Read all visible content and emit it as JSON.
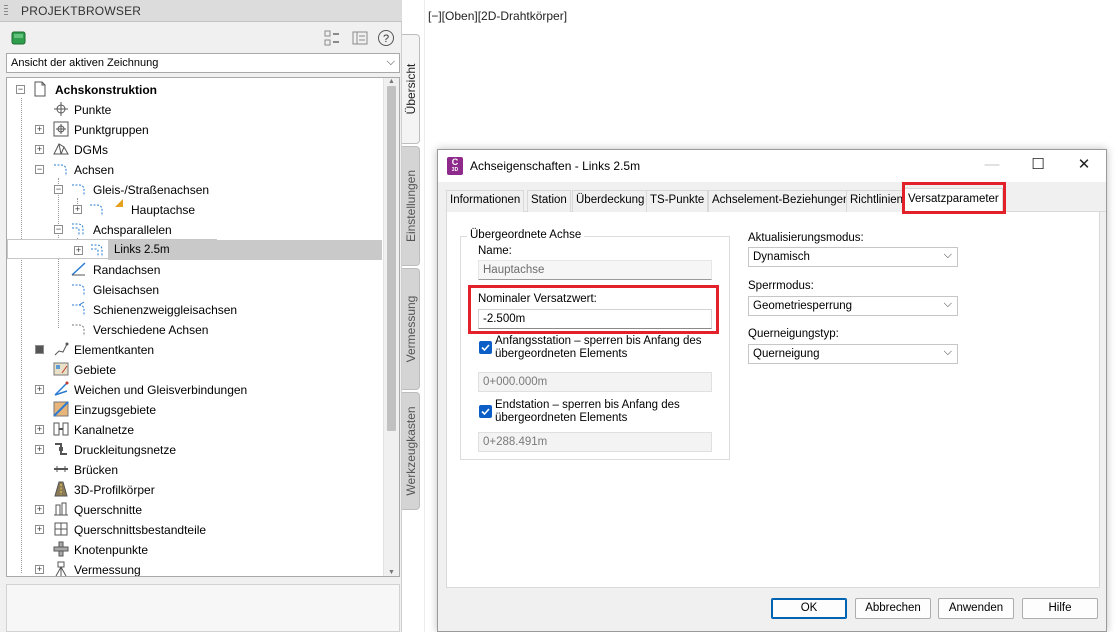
{
  "project_browser": {
    "title": "PROJEKTBROWSER",
    "view_selector": "Ansicht der aktiven Zeichnung",
    "side_tabs": [
      "Übersicht",
      "Einstellungen",
      "Vermessung",
      "Werkzeugkasten"
    ],
    "tree": {
      "root": "Achskonstruktion",
      "items": [
        {
          "label": "Punkte",
          "icon": "point-icon"
        },
        {
          "label": "Punktgruppen",
          "icon": "point-group-icon"
        },
        {
          "label": "DGMs",
          "icon": "surface-icon"
        },
        {
          "label": "Achsen",
          "icon": "alignment-icon"
        },
        {
          "label": "Gleis-/Straßenachsen",
          "icon": "alignment-icon"
        },
        {
          "label": "Hauptachse",
          "icon": "alignment-icon"
        },
        {
          "label": "Achsparallelen",
          "icon": "offset-alignment-icon"
        },
        {
          "label": "Links 2.5m",
          "icon": "offset-alignment-icon"
        },
        {
          "label": "Randachsen",
          "icon": "curb-alignment-icon"
        },
        {
          "label": "Gleisachsen",
          "icon": "rail-alignment-icon"
        },
        {
          "label": "Schienenzweiggleisachsen",
          "icon": "rail-branch-icon"
        },
        {
          "label": "Verschiedene Achsen",
          "icon": "misc-alignment-icon"
        },
        {
          "label": "Elementkanten",
          "icon": "feature-line-icon"
        },
        {
          "label": "Gebiete",
          "icon": "site-icon"
        },
        {
          "label": "Weichen und Gleisverbindungen",
          "icon": "turnout-icon"
        },
        {
          "label": "Einzugsgebiete",
          "icon": "catchment-icon"
        },
        {
          "label": "Kanalnetze",
          "icon": "pipe-network-icon"
        },
        {
          "label": "Druckleitungsnetze",
          "icon": "pressure-network-icon"
        },
        {
          "label": "Brücken",
          "icon": "bridge-icon"
        },
        {
          "label": "3D-Profilkörper",
          "icon": "corridor-icon"
        },
        {
          "label": "Querschnitte",
          "icon": "assembly-icon"
        },
        {
          "label": "Querschnittsbestandteile",
          "icon": "subassembly-icon"
        },
        {
          "label": "Knotenpunkte",
          "icon": "intersection-icon"
        },
        {
          "label": "Vermessung",
          "icon": "survey-icon"
        }
      ]
    }
  },
  "viewport": {
    "label": "[−][Oben][2D-Drahtkörper]"
  },
  "dialog": {
    "title": "Achseigenschaften - Links 2.5m",
    "app_icon_text": "C",
    "app_icon_subtext": "3D",
    "tabs": [
      "Informationen",
      "Station",
      "Überdeckung",
      "TS-Punkte",
      "Achselement-Beziehungen",
      "Richtlinien",
      "Versatzparameter"
    ],
    "active_tab": "Versatzparameter",
    "parent_group": {
      "title": "Übergeordnete Achse",
      "name_label": "Name:",
      "name_value": "Hauptachse",
      "offset_label": "Nominaler Versatzwert:",
      "offset_value": "-2.500m",
      "start_checkbox_label": "Anfangsstation – sperren bis Anfang des übergeordneten Elements",
      "start_station": "0+000.000m",
      "end_checkbox_label": "Endstation – sperren bis Anfang des übergeordneten Elements",
      "end_station": "0+288.491m"
    },
    "update_mode_label": "Aktualisierungsmodus:",
    "update_mode_value": "Dynamisch",
    "lock_mode_label": "Sperrmodus:",
    "lock_mode_value": "Geometriesperrung",
    "superelevation_label": "Querneigungstyp:",
    "superelevation_value": "Querneigung",
    "buttons": {
      "ok": "OK",
      "cancel": "Abbrechen",
      "apply": "Anwenden",
      "help": "Hilfe"
    }
  },
  "colors": {
    "highlight": "#e3212b",
    "checkbox": "#0b5fc6",
    "selection": "#c9c9c9"
  }
}
